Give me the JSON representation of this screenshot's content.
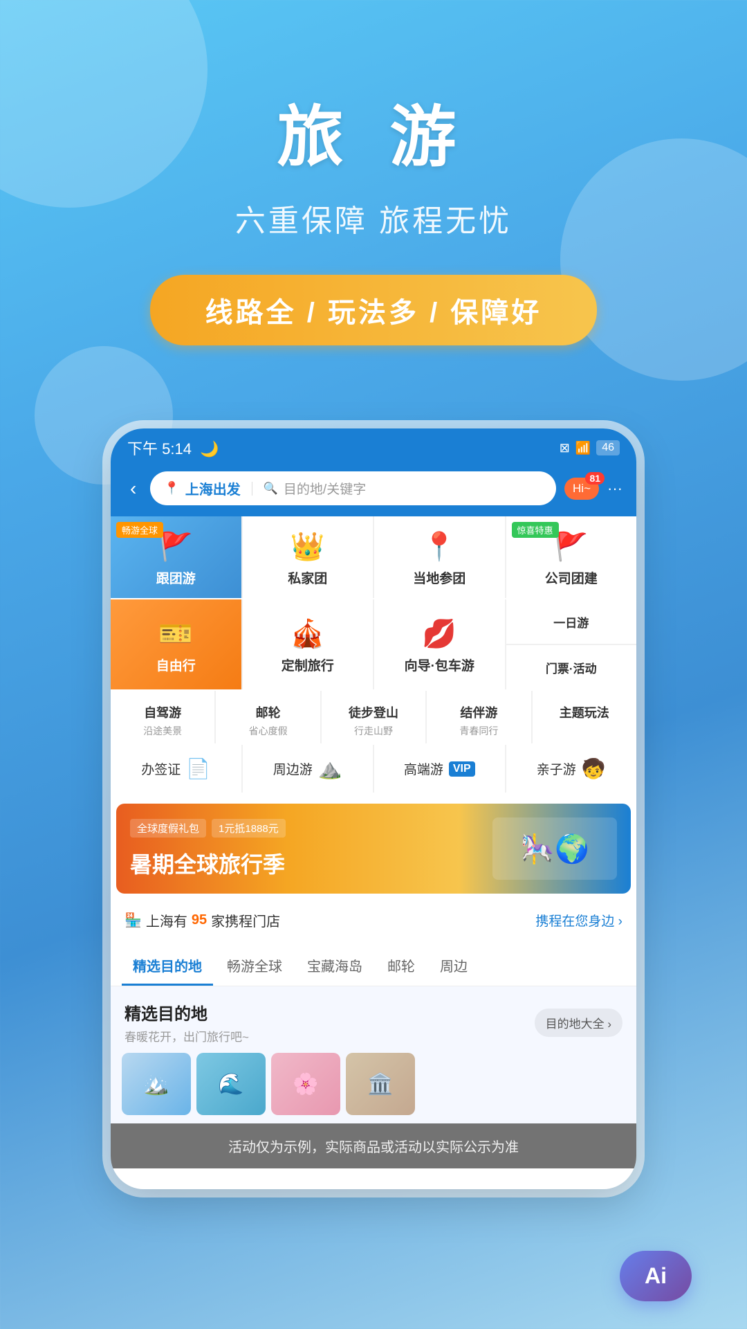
{
  "app": {
    "title": "旅 游",
    "subtitle": "六重保障 旅程无忧",
    "badge": "线路全 / 玩法多 / 保障好"
  },
  "status_bar": {
    "time": "下午 5:14",
    "battery": "46",
    "moon_icon": "🌙",
    "wifi_icon": "wifi"
  },
  "search": {
    "origin": "上海出发",
    "destination_placeholder": "目的地/关键字",
    "location_icon": "📍",
    "search_icon": "🔍"
  },
  "nav": {
    "back_label": "‹",
    "hi_label": "Hi~",
    "badge_count": "81",
    "more_label": "···"
  },
  "grid_categories": [
    {
      "id": "group-tour",
      "label": "跟团游",
      "icon": "🚩",
      "type": "featured-blue",
      "tag": "畅游全球",
      "tag_color": "orange"
    },
    {
      "id": "private-tour",
      "label": "私家团",
      "icon": "👑",
      "type": "normal"
    },
    {
      "id": "local-tour",
      "label": "当地参团",
      "icon": "📍",
      "type": "normal"
    },
    {
      "id": "corporate-tour",
      "label": "公司团建",
      "icon": "🚩",
      "type": "normal",
      "tag": "惊喜特惠",
      "tag_color": "green"
    },
    {
      "id": "free-travel",
      "label": "自由行",
      "icon": "🎫",
      "type": "featured-orange"
    },
    {
      "id": "custom-travel",
      "label": "定制旅行",
      "icon": "🎪",
      "type": "normal"
    },
    {
      "id": "guide-tour",
      "label": "向导·包车游",
      "icon": "💋",
      "type": "normal"
    },
    {
      "id": "day-tour",
      "label": "一日游",
      "sub": "门票·活动",
      "icon": "",
      "type": "text-pair"
    }
  ],
  "small_categories": [
    {
      "id": "self-drive",
      "label": "自驾游",
      "sub": "沿途美景"
    },
    {
      "id": "cruise",
      "label": "邮轮",
      "sub": "省心度假"
    },
    {
      "id": "hiking",
      "label": "徒步登山",
      "sub": "行走山野"
    },
    {
      "id": "companion",
      "label": "结伴游",
      "sub": "青春同行"
    },
    {
      "id": "theme",
      "label": "主题玩法",
      "sub": ""
    }
  ],
  "service_categories": [
    {
      "id": "visa",
      "label": "办签证",
      "icon": "📄"
    },
    {
      "id": "nearby",
      "label": "周边游",
      "icon": "⛰️"
    },
    {
      "id": "luxury",
      "label": "高端游",
      "icon": "VIP"
    },
    {
      "id": "family",
      "label": "亲子游",
      "icon": "🧒"
    }
  ],
  "banner": {
    "tag1": "全球度假礼包",
    "tag2": "1元抵1888元",
    "title": "暑期全球旅行季",
    "image_emoji": "🎠"
  },
  "store_info": {
    "prefix": "上海有",
    "highlight": "95",
    "suffix": "家携程门店",
    "link": "携程在您身边 ›"
  },
  "tabs": [
    {
      "id": "featured",
      "label": "精选目的地",
      "active": true
    },
    {
      "id": "global",
      "label": "畅游全球",
      "active": false
    },
    {
      "id": "island",
      "label": "宝藏海岛",
      "active": false
    },
    {
      "id": "cruise",
      "label": "邮轮",
      "active": false
    },
    {
      "id": "nearby",
      "label": "周边",
      "active": false
    }
  ],
  "destinations": {
    "section_title": "精选目的地",
    "section_subtitle": "春暖花开，出门旅行吧~",
    "all_button": "目的地大全 ›",
    "items": [
      {
        "emoji": "🏔️",
        "color": "#b8d4e8"
      },
      {
        "emoji": "🌊",
        "color": "#7ec8e3"
      },
      {
        "emoji": "🌸",
        "color": "#f0b8c8"
      },
      {
        "emoji": "🏛️",
        "color": "#d4c4a8"
      }
    ]
  },
  "disclaimer": {
    "text": "活动仅为示例，实际商品或活动以实际公示为准"
  },
  "ai_button": {
    "label": "Ai"
  }
}
